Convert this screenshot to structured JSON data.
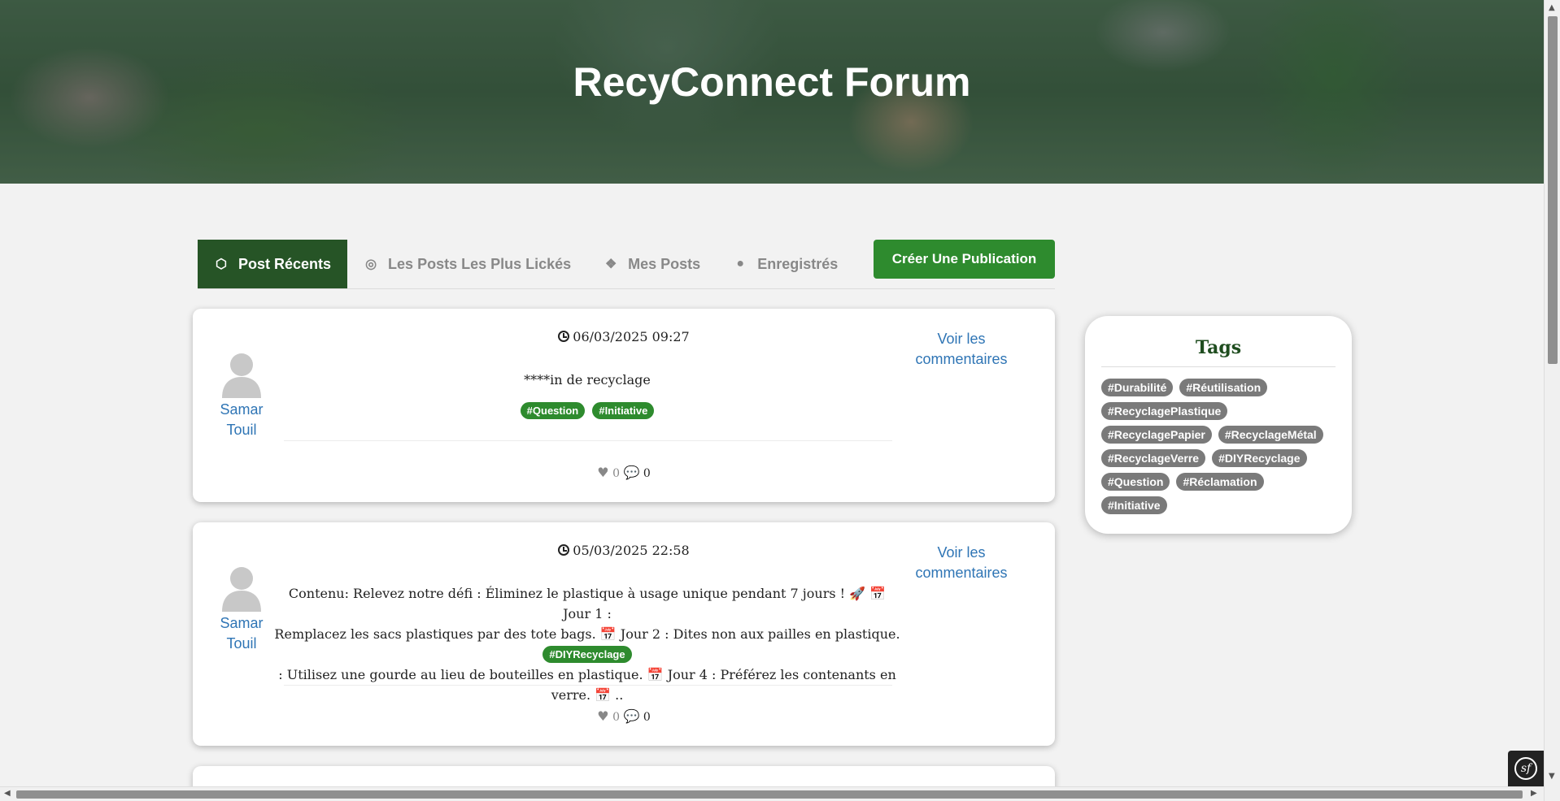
{
  "hero": {
    "title": "RecyConnect Forum"
  },
  "tabs": [
    {
      "label": "Post Récents",
      "icon": "codepen-icon",
      "active": true
    },
    {
      "label": "Les Posts Les Plus Lickés",
      "icon": "dribbble-icon",
      "active": false
    },
    {
      "label": "Mes Posts",
      "icon": "dropbox-icon",
      "active": false
    },
    {
      "label": "Enregistrés",
      "icon": "drupal-icon",
      "active": false
    }
  ],
  "create_button": {
    "label": "Créer Une Publication"
  },
  "posts": [
    {
      "author": [
        "Samar",
        "Touil"
      ],
      "date": "06/03/2025 09:27",
      "content": "****in de recyclage",
      "tags": [
        "#Question",
        "#Initiative"
      ],
      "likes": "0",
      "comments": "0",
      "view_comments": [
        "Voir les",
        "commentaires"
      ]
    },
    {
      "author": [
        "Samar",
        "Touil"
      ],
      "date": "05/03/2025 22:58",
      "content_lines": [
        "Contenu: Relevez notre défi : Éliminez le plastique à usage unique pendant 7 jours ! 🚀 📅 Jour 1 :",
        "Remplacez les sacs plastiques par des tote bags. 📅 Jour 2 : Dites non aux pailles en plastique. 📅 Jour 3",
        ": Utilisez une gourde au lieu de bouteilles en plastique. 📅 Jour 4 : Préférez les contenants en verre. 📅 .."
      ],
      "tags": [
        "#DIYRecyclage"
      ],
      "likes": "0",
      "comments": "0",
      "view_comments": [
        "Voir les",
        "commentaires"
      ]
    }
  ],
  "tags_panel": {
    "title": "Tags",
    "tags": [
      "#Durabilité",
      "#Réutilisation",
      "#RecyclagePlastique",
      "#RecyclagePapier",
      "#RecyclageMétal",
      "#RecyclageVerre",
      "#DIYRecyclage",
      "#Question",
      "#Réclamation",
      "#Initiative"
    ]
  },
  "colors": {
    "active_tab": "#265426",
    "primary_green": "#2e8b2e",
    "link_blue": "#2f75b5",
    "tag_grey": "#7a7a7a"
  }
}
